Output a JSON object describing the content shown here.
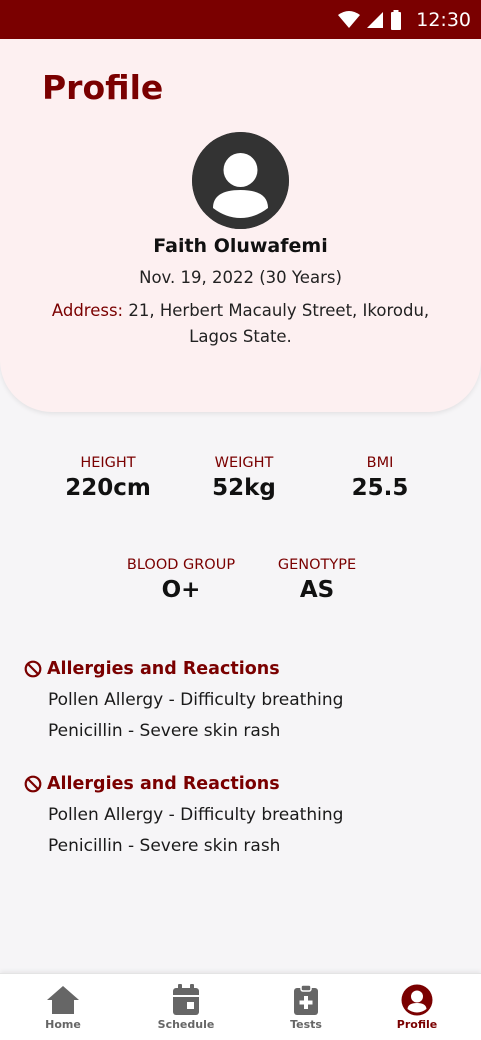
{
  "status_bar": {
    "time": "12:30"
  },
  "profile": {
    "title": "Profile",
    "name": "Faith Oluwafemi",
    "dob": "Nov. 19, 2022 (30 Years)",
    "address_label": "Address:",
    "address_value": " 21, Herbert Macauly Street, Ikorodu, Lagos State."
  },
  "stats": {
    "height": {
      "label": "HEIGHT",
      "value": "220cm"
    },
    "weight": {
      "label": "WEIGHT",
      "value": "52kg"
    },
    "bmi": {
      "label": "BMI",
      "value": "25.5"
    },
    "blood_group": {
      "label": "BLOOD GROUP",
      "value": "O+"
    },
    "genotype": {
      "label": "GENOTYPE",
      "value": "AS"
    }
  },
  "allergies": [
    {
      "title": "Allergies and Reactions",
      "items": [
        "Pollen Allergy - Difficulty breathing",
        "Penicillin - Severe skin rash"
      ]
    },
    {
      "title": "Allergies and Reactions",
      "items": [
        "Pollen Allergy - Difficulty breathing",
        "Penicillin - Severe skin rash"
      ]
    }
  ],
  "nav": {
    "items": [
      {
        "label": "Home",
        "icon": "home-icon"
      },
      {
        "label": "Schedule",
        "icon": "calendar-icon"
      },
      {
        "label": "Tests",
        "icon": "clipboard-plus-icon"
      },
      {
        "label": "Profile",
        "icon": "user-circle-icon"
      }
    ],
    "active": "Profile"
  },
  "colors": {
    "brand": "#7a0000",
    "header_bg": "#fdf0f1",
    "page_bg": "#f6f5f7",
    "inactive_icon": "#666666"
  }
}
